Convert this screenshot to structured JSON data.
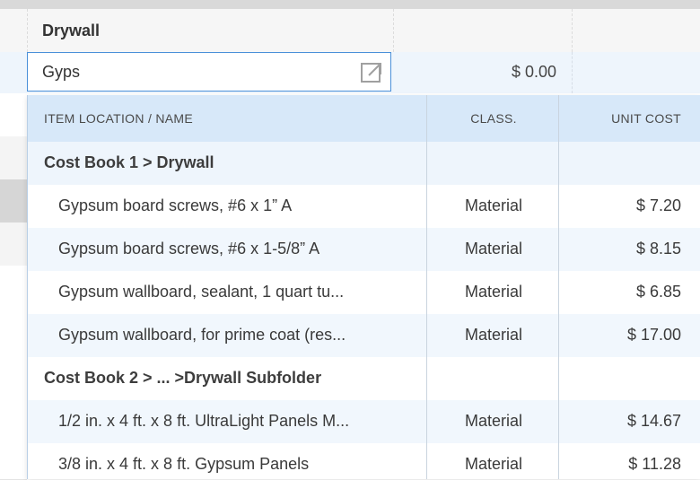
{
  "grid": {
    "section_title": "Drywall",
    "edit_row": {
      "search_value": "Gyps",
      "price": "$ 0.00"
    }
  },
  "dropdown": {
    "columns": {
      "name": "ITEM LOCATION / NAME",
      "class": "CLASS.",
      "cost": "UNIT COST"
    },
    "rows": [
      {
        "type": "group",
        "name": "Cost Book 1 > Drywall",
        "class": "",
        "cost": ""
      },
      {
        "type": "item",
        "name": "Gypsum board screws, #6 x 1” A",
        "class": "Material",
        "cost": "$ 7.20"
      },
      {
        "type": "item",
        "name": "Gypsum board screws, #6 x 1-5/8” A",
        "class": "Material",
        "cost": "$ 8.15"
      },
      {
        "type": "item",
        "name": "Gypsum wallboard, sealant, 1 quart tu...",
        "class": "Material",
        "cost": "$ 6.85"
      },
      {
        "type": "item",
        "name": "Gypsum wallboard, for prime coat (res...",
        "class": "Material",
        "cost": "$ 17.00"
      },
      {
        "type": "group",
        "name": "Cost Book 2 > ... >Drywall Subfolder",
        "class": "",
        "cost": ""
      },
      {
        "type": "item",
        "name": "1/2 in. x 4 ft. x 8 ft. UltraLight Panels M...",
        "class": "Material",
        "cost": "$ 14.67"
      },
      {
        "type": "item",
        "name": "3/8 in. x 4 ft. x 8 ft. Gypsum Panels",
        "class": "Material",
        "cost": "$ 11.28"
      }
    ]
  },
  "icons": {
    "open": "external-link-icon"
  },
  "colors": {
    "accent": "#4a90d9",
    "header_bg": "#d7e8f9",
    "alt_row": "#f1f7fd"
  }
}
